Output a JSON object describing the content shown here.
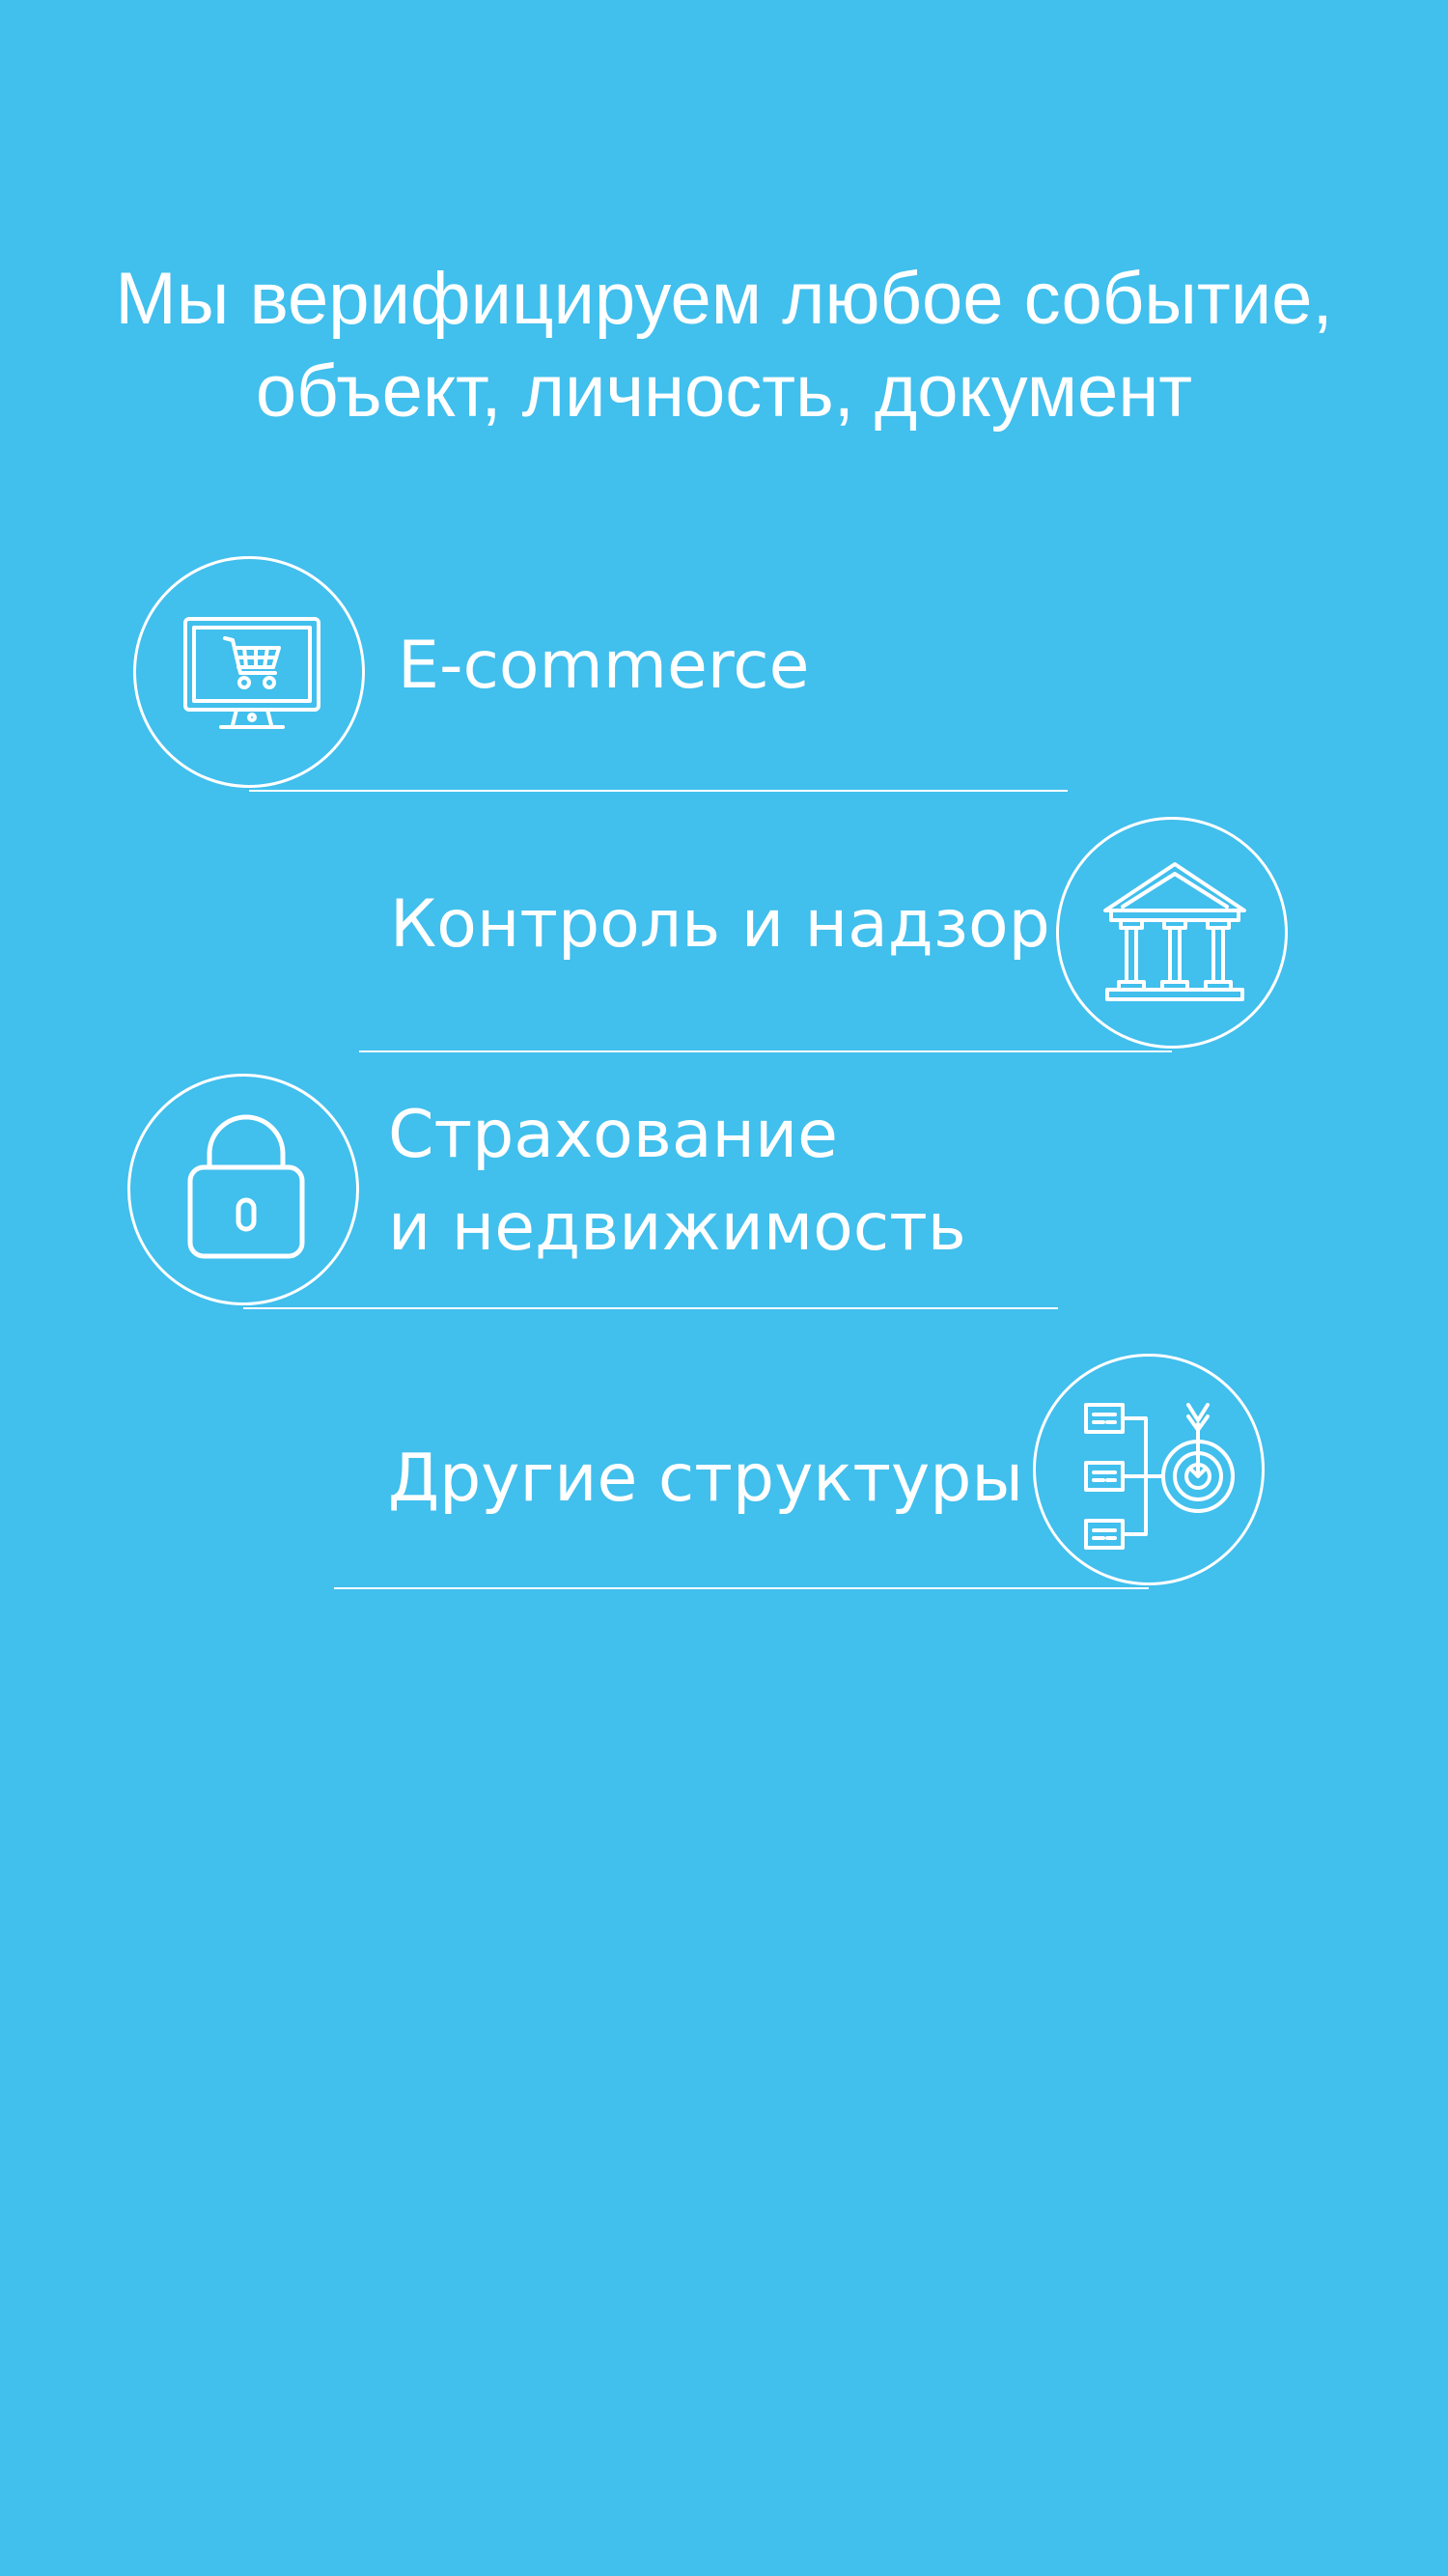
{
  "headline": {
    "line1": "Мы верифицируем любое событие,",
    "line2": "объект, личность, документ"
  },
  "items": [
    {
      "label": "E-commerce",
      "icon": "monitor-cart-icon"
    },
    {
      "label": "Контроль и надзор",
      "icon": "bank-building-icon"
    },
    {
      "label_line1": "Страхование",
      "label_line2": "и недвижимость",
      "icon": "padlock-icon"
    },
    {
      "label": "Другие структуры",
      "icon": "target-flowchart-icon"
    }
  ],
  "colors": {
    "background": "#41bfed",
    "foreground": "#ffffff"
  }
}
